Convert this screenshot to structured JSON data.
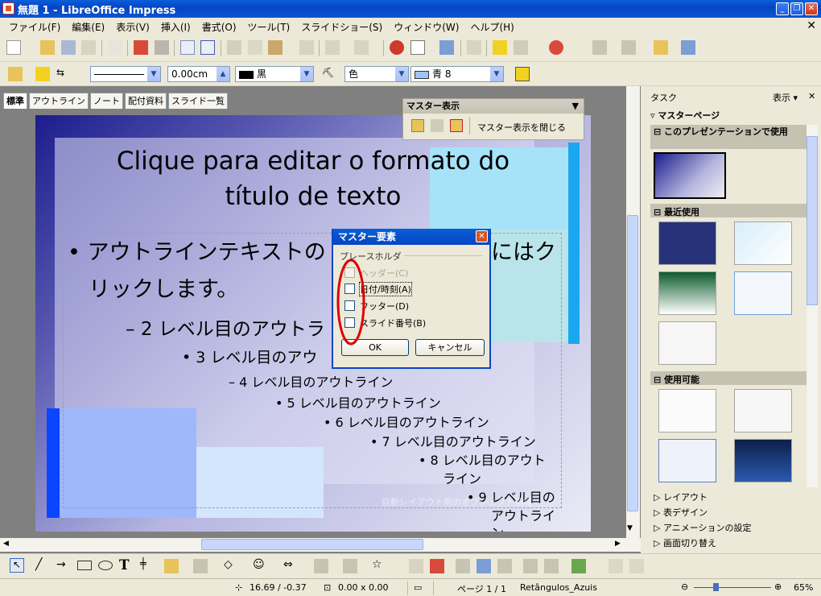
{
  "window": {
    "title": "無題 1 - LibreOffice Impress"
  },
  "menu": [
    "ファイル(F)",
    "編集(E)",
    "表示(V)",
    "挿入(I)",
    "書式(O)",
    "ツール(T)",
    "スライドショー(S)",
    "ウィンドウ(W)",
    "ヘルプ(H)"
  ],
  "format_toolbar": {
    "line_width": "0.00cm",
    "line_color": "黒",
    "area_style": "色",
    "area_color": "青 8"
  },
  "view_tabs": [
    "標準",
    "アウトライン",
    "ノート",
    "配付資料",
    "スライド一覧"
  ],
  "master_view_bar": {
    "title": "マスター表示",
    "close_label": "マスター表示を閉じる"
  },
  "slide": {
    "title": "Clique para editar o formato do título de texto",
    "title_line1": "Clique para editar o formato do",
    "title_line2": "título de texto",
    "level1_a": "アウトラインテキストの",
    "level1_b": "にはク",
    "level1_c": "リックします。",
    "level2": "2 レベル目のアウトラ",
    "level3": "3 レベル目のアウ",
    "level4": "4 レベル目のアウトライン",
    "level5": "5 レベル目のアウトライン",
    "level6": "6 レベル目のアウトライン",
    "level7": "7 レベル目のアウトライン",
    "level8a": "8 レベル目のアウト",
    "level8b": "ライン",
    "level9a": "9 レベル目の",
    "level9b": "アウトライ",
    "level9c": "ン",
    "faint_text": "自動レイアウト用のオブジェクト領域"
  },
  "dialog": {
    "title": "マスター要素",
    "group": "プレースホルダ",
    "items": [
      {
        "label": "ヘッダー(C)",
        "checked": false,
        "enabled": false
      },
      {
        "label": "日付/時刻(A)",
        "checked": false,
        "enabled": true
      },
      {
        "label": "フッター(D)",
        "checked": false,
        "enabled": true
      },
      {
        "label": "スライド番号(B)",
        "checked": false,
        "enabled": true
      }
    ],
    "ok": "OK",
    "cancel": "キャンセル"
  },
  "task_pane": {
    "title": "タスク",
    "view_menu": "表示",
    "section": "マスターページ",
    "used_header": "このプレゼンテーションで使用",
    "recent_header": "最近使用",
    "available_header": "使用可能",
    "collapsed": [
      "レイアウト",
      "表デザイン",
      "アニメーションの設定",
      "画面切り替え"
    ]
  },
  "status": {
    "position": "16.69 / -0.37",
    "size": "0.00 x 0.00",
    "page": "ページ 1 / 1",
    "master": "Retângulos_Azuis",
    "zoom": "65%"
  },
  "colors": {
    "accent": "#0a5fd8",
    "slide_dark": "#1c1d8c",
    "annotation": "#e00000"
  }
}
